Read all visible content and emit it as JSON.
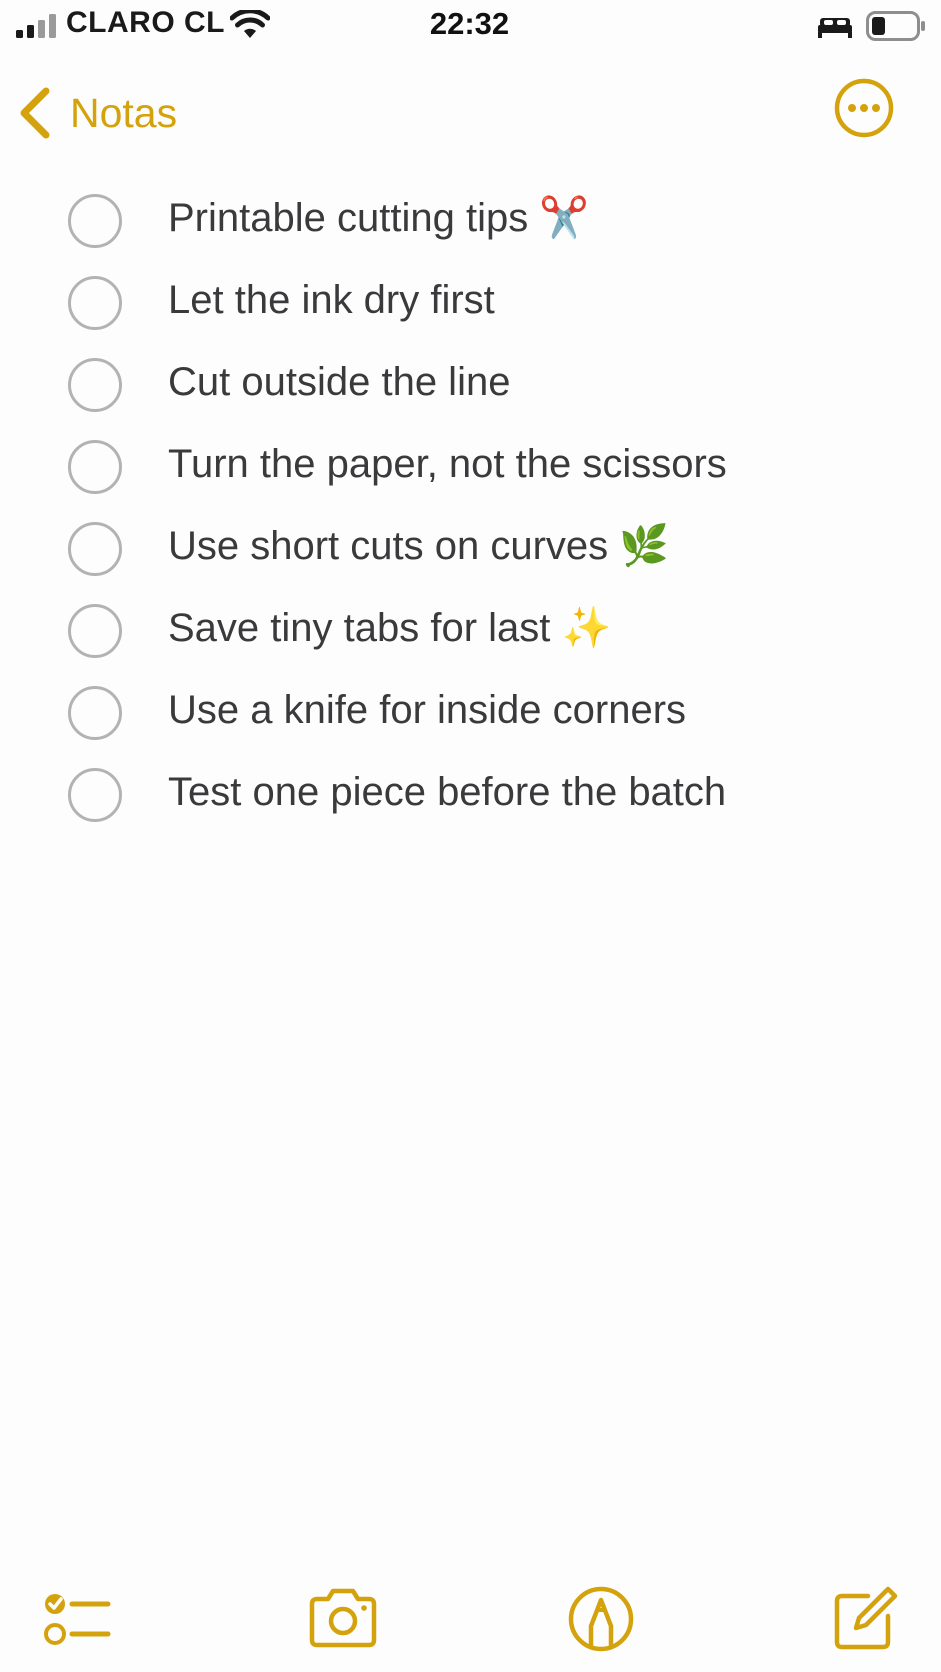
{
  "status_bar": {
    "carrier": "CLARO CL",
    "time": "22:32",
    "icons": [
      "signal-icon",
      "wifi-icon",
      "bed-icon",
      "battery-icon"
    ]
  },
  "nav": {
    "back_label": "Notas",
    "back_icon": "chevron-left-icon",
    "more_icon": "ellipsis-circle-icon"
  },
  "checklist": [
    {
      "text": "Printable cutting tips ✂️",
      "checked": false
    },
    {
      "text": "Let the ink dry first",
      "checked": false
    },
    {
      "text": "Cut outside the line",
      "checked": false
    },
    {
      "text": "Turn the paper, not the scissors",
      "checked": false
    },
    {
      "text": "Use short cuts on curves 🌿",
      "checked": false
    },
    {
      "text": "Save tiny tabs for last ✨",
      "checked": false
    },
    {
      "text": "Use a knife for inside corners",
      "checked": false
    },
    {
      "text": "Test one piece before the batch",
      "checked": false
    }
  ],
  "toolbar": {
    "icons": [
      "checklist-icon",
      "camera-icon",
      "markup-icon",
      "compose-icon"
    ]
  },
  "colors": {
    "accent": "#d4a20c",
    "text": "#3a3a3c",
    "circle": "#b3b3b3",
    "background": "#fdfdfd"
  }
}
